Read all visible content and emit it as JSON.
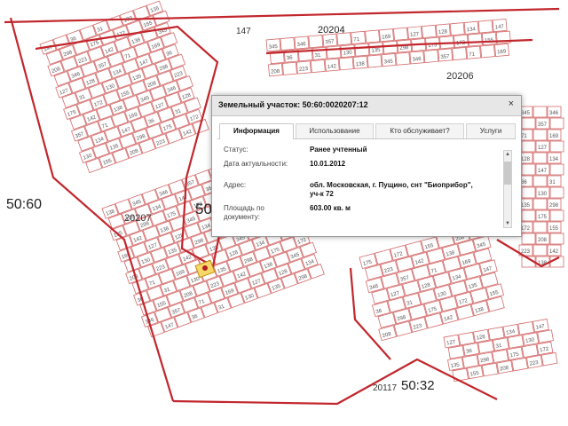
{
  "map": {
    "colors": {
      "boundary": "#c1272d",
      "parcel": "#d46a6a",
      "marker": "#d9a400"
    },
    "labels": {
      "quarter_147": "147",
      "quarter_20204": "20204",
      "quarter_20206": "20206",
      "quarter_20207": "20207",
      "district_50_60": "50:60",
      "district_partial": "50",
      "quarter_20117": "20117",
      "district_50_32": "50:32"
    },
    "parcel_numbers": [
      "147",
      "36",
      "31",
      "130",
      "135",
      "298",
      "175",
      "172",
      "155",
      "208",
      "223",
      "142",
      "138",
      "345",
      "346",
      "357",
      "71",
      "169",
      "127",
      "128",
      "134"
    ]
  },
  "popup": {
    "title": "Земельный участок: 50:60:0020207:12",
    "close_icon": "×",
    "tabs": [
      "Информация",
      "Использование",
      "Кто обслуживает?",
      "Услуги"
    ],
    "active_tab": "Информация",
    "fields": {
      "status_label": "Статус:",
      "status_value": "Ранее учтенный",
      "date_label": "Дата актуальности:",
      "date_value": "10.01.2012",
      "address_label": "Адрес:",
      "address_value_1": "обл. Московская, г. Пущино, снт \"Биоприбор\",",
      "address_value_2": "уч-к 72",
      "area_label_1": "Площадь по",
      "area_label_2": "документу:",
      "area_value": "603.00 кв. м"
    }
  }
}
